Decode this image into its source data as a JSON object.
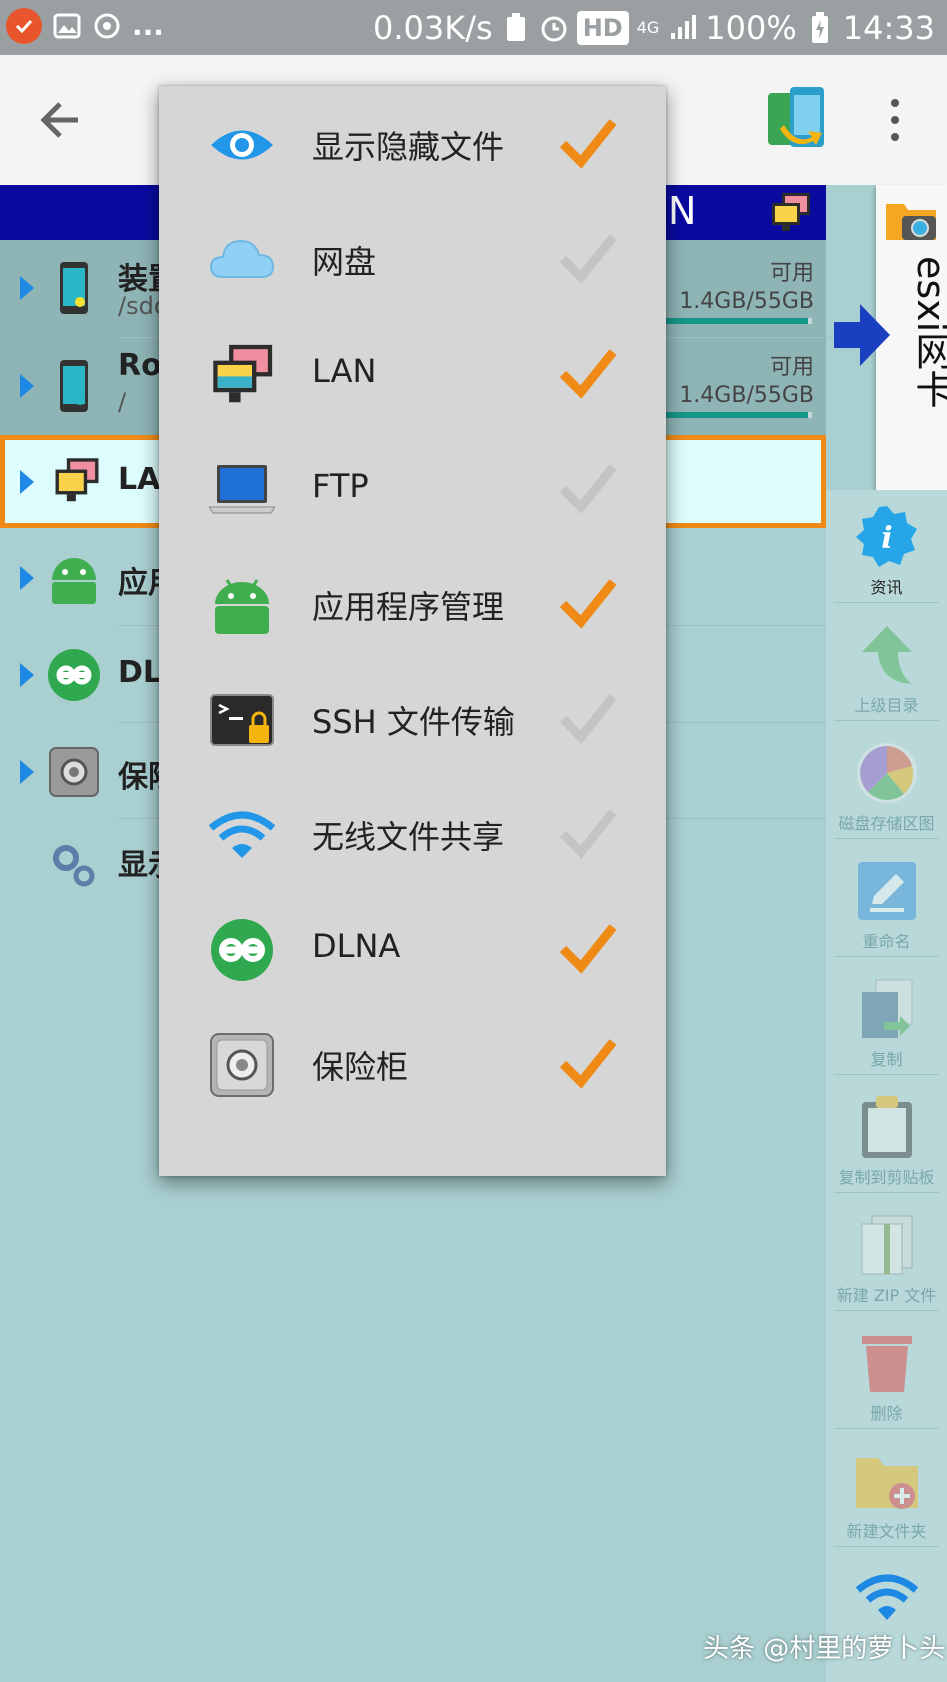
{
  "status_bar": {
    "network_speed": "0.03K/s",
    "hd_badge": "HD",
    "network_type": "4G",
    "battery": "100%",
    "time": "14:33",
    "more_indicator": "..."
  },
  "toolbar": {
    "back_icon": "arrow-left-icon",
    "remote_icon": "phone-transfer-icon",
    "overflow_icon": "more-vertical-icon"
  },
  "list": {
    "band_label": "N",
    "rows": [
      {
        "title": "装置",
        "subtitle": "/sdc",
        "avail_label": "可用",
        "avail_value": "1.4GB/55GB",
        "usage_fraction": 0.97
      },
      {
        "title": "Roo",
        "subtitle": "/",
        "avail_label": "可用",
        "avail_value": "1.4GB/55GB",
        "usage_fraction": 0.97
      },
      {
        "title": "LA"
      },
      {
        "title": "应用"
      },
      {
        "title": "DLN"
      },
      {
        "title": "保险"
      },
      {
        "title": "显示"
      }
    ]
  },
  "esxi_tab": {
    "label": "esxi网卡"
  },
  "side_panel": {
    "items": [
      {
        "label": "资讯",
        "icon": "info-icon"
      },
      {
        "label": "上级目录",
        "icon": "up-arrow-icon"
      },
      {
        "label": "磁盘存储区图",
        "icon": "disk-chart-icon"
      },
      {
        "label": "重命名",
        "icon": "rename-icon"
      },
      {
        "label": "复制",
        "icon": "copy-icon"
      },
      {
        "label": "复制到剪贴板",
        "icon": "clipboard-icon"
      },
      {
        "label": "新建 ZIP 文件",
        "icon": "zip-icon"
      },
      {
        "label": "删除",
        "icon": "trash-icon"
      },
      {
        "label": "新建文件夹",
        "icon": "new-folder-icon"
      },
      {
        "label": "",
        "icon": "wifi-icon"
      }
    ]
  },
  "popup_menu": {
    "items": [
      {
        "label": "显示隐藏文件",
        "icon": "eye-icon",
        "checked": true
      },
      {
        "label": "网盘",
        "icon": "cloud-icon",
        "checked": false
      },
      {
        "label": "LAN",
        "icon": "lan-icon",
        "checked": true
      },
      {
        "label": "FTP",
        "icon": "ftp-icon",
        "checked": false
      },
      {
        "label": "应用程序管理",
        "icon": "android-icon",
        "checked": true
      },
      {
        "label": "SSH 文件传输",
        "icon": "terminal-lock-icon",
        "checked": false
      },
      {
        "label": "无线文件共享",
        "icon": "wifi-icon",
        "checked": false
      },
      {
        "label": "DLNA",
        "icon": "dlna-icon",
        "checked": true
      },
      {
        "label": "保险柜",
        "icon": "safe-icon",
        "checked": true
      }
    ]
  },
  "watermark": "头条 @村里的萝卜头",
  "colors": {
    "accent_orange": "#ef8a17",
    "check_off": "#c4c4c4",
    "band_blue": "#0a0aa0",
    "background": "#a9cfd0"
  }
}
